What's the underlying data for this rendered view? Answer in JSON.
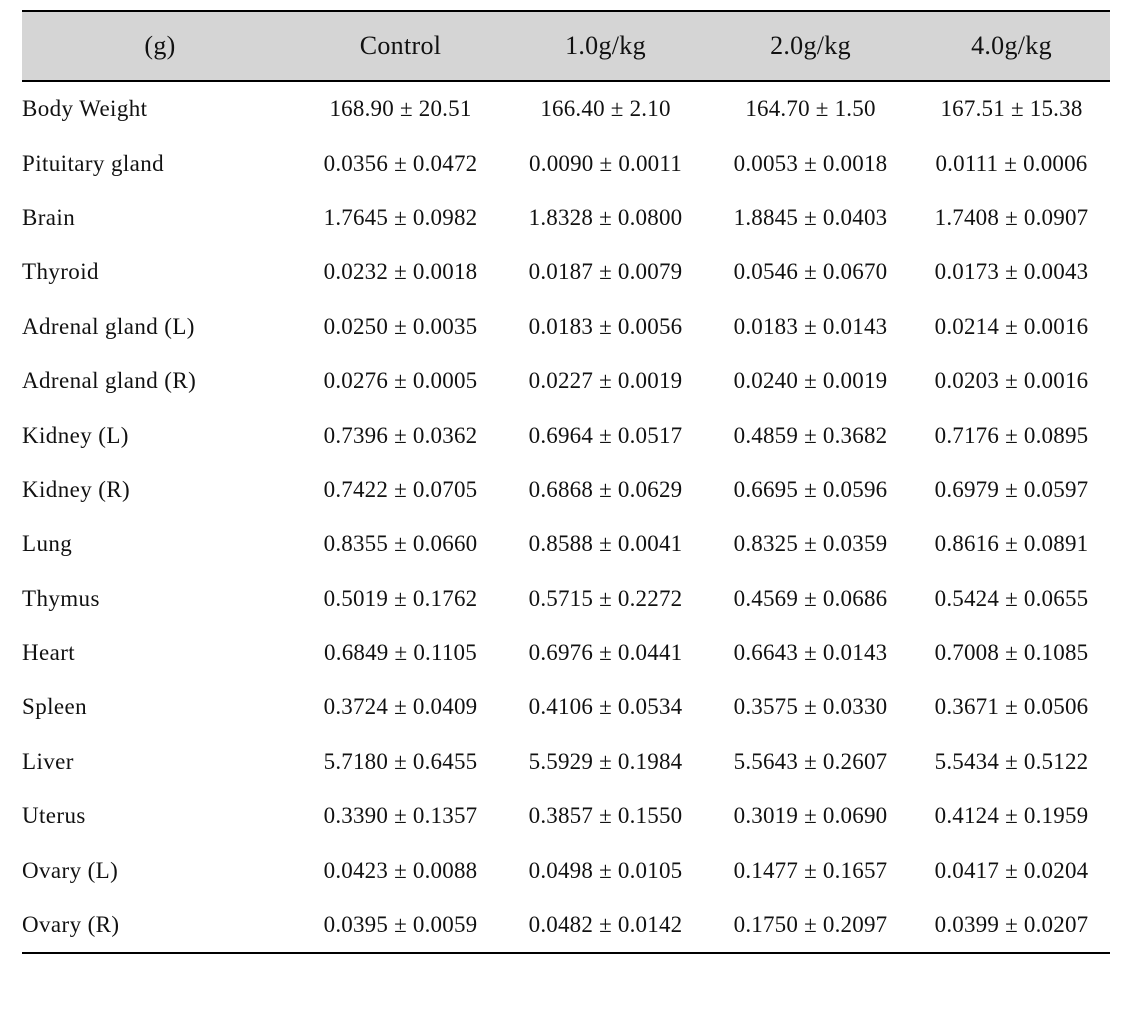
{
  "table": {
    "unit_header": "(g)",
    "columns": [
      "Control",
      "1.0g/kg",
      "2.0g/kg",
      "4.0g/kg"
    ],
    "separator": "±",
    "rows": [
      {
        "label": "Body Weight",
        "values": [
          {
            "mean": "168.90",
            "sd": "20.51"
          },
          {
            "mean": "166.40",
            "sd": "2.10"
          },
          {
            "mean": "164.70",
            "sd": "1.50"
          },
          {
            "mean": "167.51",
            "sd": "15.38"
          }
        ]
      },
      {
        "label": "Pituitary gland",
        "values": [
          {
            "mean": "0.0356",
            "sd": "0.0472"
          },
          {
            "mean": "0.0090",
            "sd": "0.0011"
          },
          {
            "mean": "0.0053",
            "sd": "0.0018"
          },
          {
            "mean": "0.0111",
            "sd": "0.0006"
          }
        ]
      },
      {
        "label": "Brain",
        "values": [
          {
            "mean": "1.7645",
            "sd": "0.0982"
          },
          {
            "mean": "1.8328",
            "sd": "0.0800"
          },
          {
            "mean": "1.8845",
            "sd": "0.0403"
          },
          {
            "mean": "1.7408",
            "sd": "0.0907"
          }
        ]
      },
      {
        "label": "Thyroid",
        "values": [
          {
            "mean": "0.0232",
            "sd": "0.0018"
          },
          {
            "mean": "0.0187",
            "sd": "0.0079"
          },
          {
            "mean": "0.0546",
            "sd": "0.0670"
          },
          {
            "mean": "0.0173",
            "sd": "0.0043"
          }
        ]
      },
      {
        "label": "Adrenal gland (L)",
        "values": [
          {
            "mean": "0.0250",
            "sd": "0.0035"
          },
          {
            "mean": "0.0183",
            "sd": "0.0056"
          },
          {
            "mean": "0.0183",
            "sd": "0.0143"
          },
          {
            "mean": "0.0214",
            "sd": "0.0016"
          }
        ]
      },
      {
        "label": "Adrenal gland (R)",
        "values": [
          {
            "mean": "0.0276",
            "sd": "0.0005"
          },
          {
            "mean": "0.0227",
            "sd": "0.0019"
          },
          {
            "mean": "0.0240",
            "sd": "0.0019"
          },
          {
            "mean": "0.0203",
            "sd": "0.0016"
          }
        ]
      },
      {
        "label": "Kidney (L)",
        "values": [
          {
            "mean": "0.7396",
            "sd": "0.0362"
          },
          {
            "mean": "0.6964",
            "sd": "0.0517"
          },
          {
            "mean": "0.4859",
            "sd": "0.3682"
          },
          {
            "mean": "0.7176",
            "sd": "0.0895"
          }
        ]
      },
      {
        "label": "Kidney (R)",
        "values": [
          {
            "mean": "0.7422",
            "sd": "0.0705"
          },
          {
            "mean": "0.6868",
            "sd": "0.0629"
          },
          {
            "mean": "0.6695",
            "sd": "0.0596"
          },
          {
            "mean": "0.6979",
            "sd": "0.0597"
          }
        ]
      },
      {
        "label": "Lung",
        "values": [
          {
            "mean": "0.8355",
            "sd": "0.0660"
          },
          {
            "mean": "0.8588",
            "sd": "0.0041"
          },
          {
            "mean": "0.8325",
            "sd": "0.0359"
          },
          {
            "mean": "0.8616",
            "sd": "0.0891"
          }
        ]
      },
      {
        "label": "Thymus",
        "values": [
          {
            "mean": "0.5019",
            "sd": "0.1762"
          },
          {
            "mean": "0.5715",
            "sd": "0.2272"
          },
          {
            "mean": "0.4569",
            "sd": "0.0686"
          },
          {
            "mean": "0.5424",
            "sd": "0.0655"
          }
        ]
      },
      {
        "label": "Heart",
        "values": [
          {
            "mean": "0.6849",
            "sd": "0.1105"
          },
          {
            "mean": "0.6976",
            "sd": "0.0441"
          },
          {
            "mean": "0.6643",
            "sd": "0.0143"
          },
          {
            "mean": "0.7008",
            "sd": "0.1085"
          }
        ]
      },
      {
        "label": "Spleen",
        "values": [
          {
            "mean": "0.3724",
            "sd": "0.0409"
          },
          {
            "mean": "0.4106",
            "sd": "0.0534"
          },
          {
            "mean": "0.3575",
            "sd": "0.0330"
          },
          {
            "mean": "0.3671",
            "sd": "0.0506"
          }
        ]
      },
      {
        "label": "Liver",
        "values": [
          {
            "mean": "5.7180",
            "sd": "0.6455"
          },
          {
            "mean": "5.5929",
            "sd": "0.1984"
          },
          {
            "mean": "5.5643",
            "sd": "0.2607"
          },
          {
            "mean": "5.5434",
            "sd": "0.5122"
          }
        ]
      },
      {
        "label": "Uterus",
        "values": [
          {
            "mean": "0.3390",
            "sd": "0.1357"
          },
          {
            "mean": "0.3857",
            "sd": "0.1550"
          },
          {
            "mean": "0.3019",
            "sd": "0.0690"
          },
          {
            "mean": "0.4124",
            "sd": "0.1959"
          }
        ]
      },
      {
        "label": "Ovary (L)",
        "values": [
          {
            "mean": "0.0423",
            "sd": "0.0088"
          },
          {
            "mean": "0.0498",
            "sd": "0.0105"
          },
          {
            "mean": "0.1477",
            "sd": "0.1657"
          },
          {
            "mean": "0.0417",
            "sd": "0.0204"
          }
        ]
      },
      {
        "label": "Ovary (R)",
        "values": [
          {
            "mean": "0.0395",
            "sd": "0.0059"
          },
          {
            "mean": "0.0482",
            "sd": "0.0142"
          },
          {
            "mean": "0.1750",
            "sd": "0.2097"
          },
          {
            "mean": "0.0399",
            "sd": "0.0207"
          }
        ]
      }
    ]
  },
  "style": {
    "header_background": "#d5d5d5",
    "rule_color": "#000000",
    "text_color": "#111111",
    "page_background": "#ffffff"
  }
}
